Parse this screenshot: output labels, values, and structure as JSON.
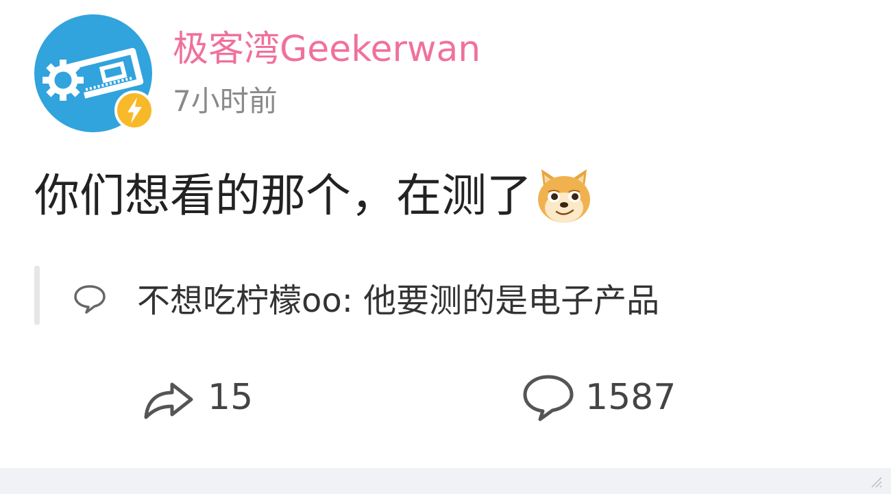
{
  "author": {
    "name": "极客湾Geekerwan",
    "time": "7小时前",
    "avatar_icon": "gear-circuit-logo",
    "badge_icon": "lightning-badge-icon",
    "name_color": "#f0719b"
  },
  "post": {
    "text": "你们想看的那个，在测了",
    "emoji": "doge-emoji"
  },
  "hot_comment": {
    "icon": "comment-bubble-icon",
    "text": "不想吃柠檬oo: 他要测的是电子产品"
  },
  "actions": {
    "repost_icon": "share-arrow-icon",
    "repost_count": "15",
    "comment_icon": "comment-icon",
    "comment_count": "1587"
  },
  "colors": {
    "avatar_blue": "#31a3dd",
    "badge_yellow": "#f7b928",
    "footer_gray": "#f1f2f5"
  }
}
